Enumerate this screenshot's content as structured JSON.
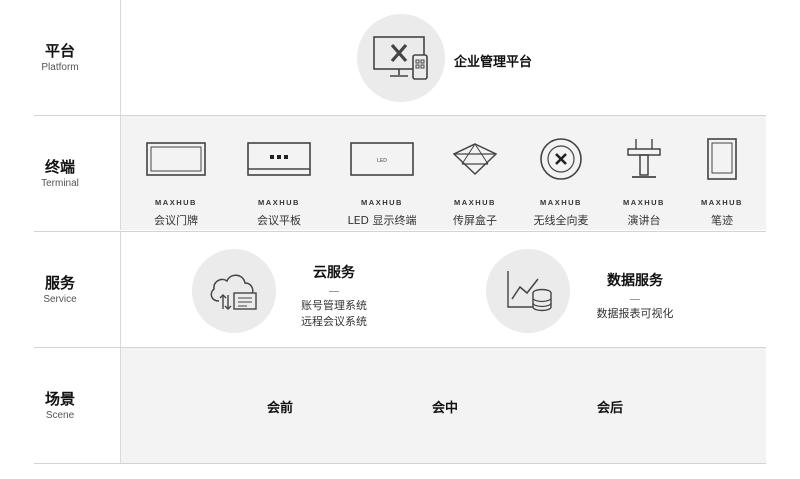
{
  "rows": {
    "platform": {
      "cn": "平台",
      "en": "Platform"
    },
    "terminal": {
      "cn": "终端",
      "en": "Terminal"
    },
    "service": {
      "cn": "服务",
      "en": "Service"
    },
    "scene": {
      "cn": "场景",
      "en": "Scene"
    }
  },
  "platform": {
    "label": "企业管理平台",
    "icon": "monitor-phone-icon"
  },
  "terminals": [
    {
      "brand": "MAXHUB",
      "name": "会议门牌",
      "icon": "display-panel-icon"
    },
    {
      "brand": "MAXHUB",
      "name": "会议平板",
      "icon": "meeting-tablet-icon"
    },
    {
      "brand": "MAXHUB",
      "name": "LED 显示终端",
      "icon": "led-display-icon"
    },
    {
      "brand": "MAXHUB",
      "name": "传屏盒子",
      "icon": "cast-box-icon"
    },
    {
      "brand": "MAXHUB",
      "name": "无线全向麦",
      "icon": "omni-mic-icon"
    },
    {
      "brand": "MAXHUB",
      "name": "演讲台",
      "icon": "podium-icon"
    },
    {
      "brand": "MAXHUB",
      "name": "笔迹",
      "icon": "writing-pad-icon"
    }
  ],
  "led_mark": "LED",
  "services": [
    {
      "title": "云服务",
      "lines": [
        "账号管理系统",
        "远程会议系统"
      ],
      "icon": "cloud-service-icon"
    },
    {
      "title": "数据服务",
      "lines": [
        "数据报表可视化"
      ],
      "icon": "data-chart-icon"
    }
  ],
  "scenes": [
    "会前",
    "会中",
    "会后"
  ],
  "colors": {
    "panel": "#f3f3f3",
    "circle": "#ebebeb",
    "divider": "#d3d3d3",
    "icon_stroke": "#444444"
  }
}
